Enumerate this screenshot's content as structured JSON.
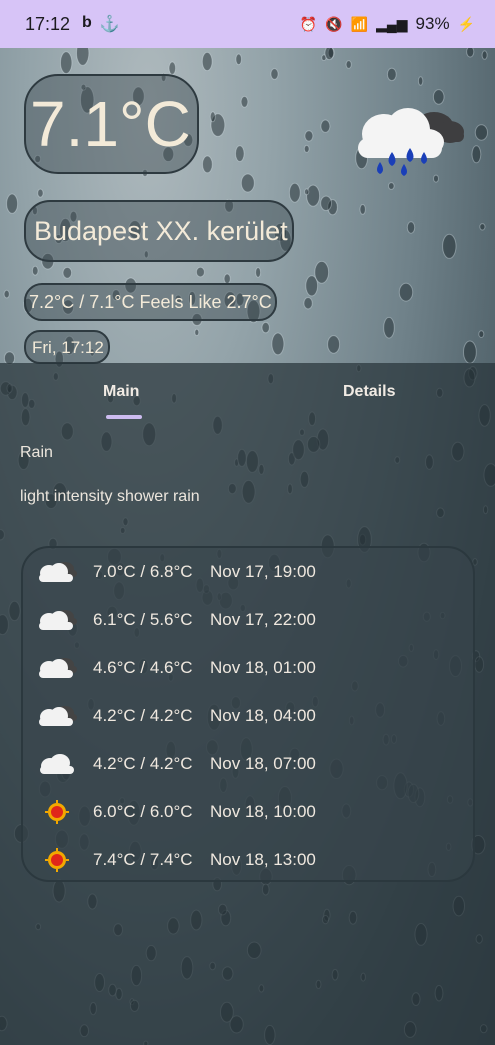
{
  "status_bar": {
    "time": "17:12",
    "left_icons": [
      "b-icon",
      "anchor-icon"
    ],
    "battery": "93%"
  },
  "current": {
    "temperature": "7.1°C",
    "city": "Budapest XX. kerület",
    "minmax_feels": "7.2°C / 7.1°C Feels Like 2.7°C",
    "date": "Fri, 17:12",
    "icon": "cloud-rain-icon"
  },
  "tabs": [
    {
      "label": "Main",
      "selected": true
    },
    {
      "label": "Details",
      "selected": false
    }
  ],
  "main": {
    "condition": "Rain",
    "description": "light intensity shower rain"
  },
  "forecast": [
    {
      "icon": "partly-cloudy-icon",
      "temps": "7.0°C / 6.8°C",
      "when": "Nov 17, 19:00"
    },
    {
      "icon": "partly-cloudy-icon",
      "temps": "6.1°C / 5.6°C",
      "when": "Nov 17, 22:00"
    },
    {
      "icon": "partly-cloudy-icon",
      "temps": "4.6°C / 4.6°C",
      "when": "Nov 18, 01:00"
    },
    {
      "icon": "partly-cloudy-icon",
      "temps": "4.2°C / 4.2°C",
      "when": "Nov 18, 04:00"
    },
    {
      "icon": "cloud-icon",
      "temps": "4.2°C / 4.2°C",
      "when": "Nov 18, 07:00"
    },
    {
      "icon": "sun-icon",
      "temps": "6.0°C / 6.0°C",
      "when": "Nov 18, 10:00"
    },
    {
      "icon": "sun-icon",
      "temps": "7.4°C / 7.4°C",
      "when": "Nov 18, 13:00"
    }
  ],
  "colors": {
    "status_bar": "#d7c4f7",
    "tab_indicator": "#cdbcf0",
    "text": "#f3ead8"
  }
}
